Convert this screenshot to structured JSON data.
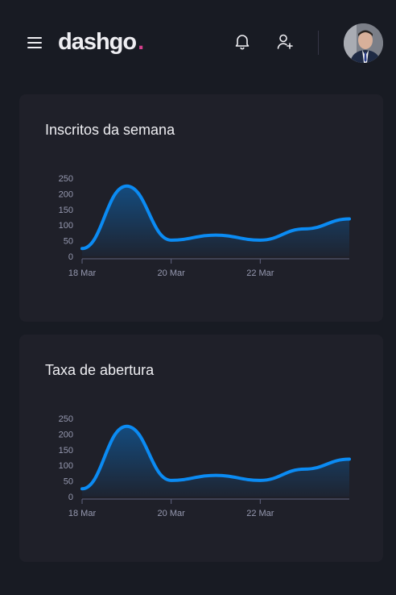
{
  "header": {
    "logo_text": "dashgo",
    "logo_dot": ".",
    "colors": {
      "background": "#181b23",
      "card": "#1f2029",
      "accent": "#d53f8c",
      "line": "#0b8bf3"
    },
    "icons": [
      "menu-icon",
      "bell-icon",
      "user-plus-icon",
      "avatar"
    ]
  },
  "cards": [
    {
      "title": "Inscritos da semana",
      "chart_data": {
        "type": "area",
        "x": [
          "18 Mar",
          "19 Mar",
          "20 Mar",
          "21 Mar",
          "22 Mar",
          "23 Mar",
          "24 Mar"
        ],
        "values": [
          25,
          225,
          52,
          68,
          52,
          88,
          120
        ],
        "x_tick_labels": [
          "18 Mar",
          "20 Mar",
          "22 Mar"
        ],
        "y_ticks": [
          "250",
          "200",
          "150",
          "100",
          "50",
          "0"
        ],
        "ylim": [
          0,
          250
        ],
        "grid": false
      }
    },
    {
      "title": "Taxa de abertura",
      "chart_data": {
        "type": "area",
        "x": [
          "18 Mar",
          "19 Mar",
          "20 Mar",
          "21 Mar",
          "22 Mar",
          "23 Mar",
          "24 Mar"
        ],
        "values": [
          25,
          225,
          52,
          68,
          52,
          88,
          120
        ],
        "x_tick_labels": [
          "18 Mar",
          "20 Mar",
          "22 Mar"
        ],
        "y_ticks": [
          "250",
          "200",
          "150",
          "100",
          "50",
          "0"
        ],
        "ylim": [
          0,
          250
        ],
        "grid": false
      }
    }
  ]
}
